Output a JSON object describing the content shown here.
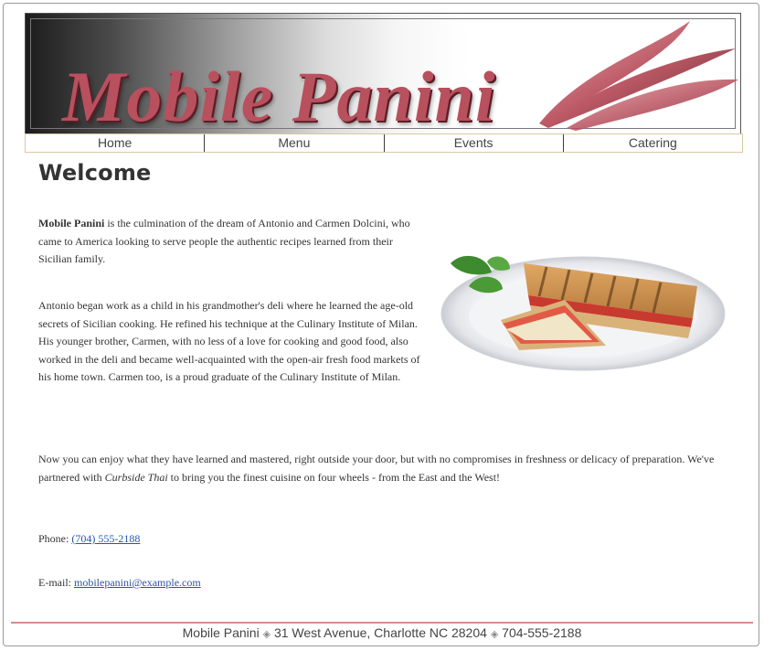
{
  "banner": {
    "logo": "Mobile Panini"
  },
  "nav": {
    "items": [
      "Home",
      "Menu",
      "Events",
      "Catering"
    ]
  },
  "main": {
    "heading": "Welcome",
    "p1_bold": "Mobile Panini",
    "p1_rest": " is the culmination of the dream of Antonio and Carmen Dolcini, who came to America looking to serve people the authentic recipes learned from their Sicilian family.",
    "p2": "Antonio began work as a child in his grandmother's deli where he learned the age-old secrets of Sicilian cooking. He refined his technique at the Culinary Institute of Milan. His younger brother, Carmen, with no less of a love for cooking and good food, also worked in the deli and became well-acquainted with the open-air fresh food markets of his home town. Carmen too, is a proud graduate of the Culinary Institute of Milan.",
    "p3_a": "Now you can enjoy what they have learned and mastered, right outside your door, but with no compromises in freshness or delicacy of preparation. We've partnered with ",
    "p3_italic": "Curbside Thai",
    "p3_b": " to bring you the finest cuisine on four wheels - from the East and the West!",
    "phone_label": "Phone: ",
    "phone_link": "(704) 555-2188",
    "email_label": "E-mail: ",
    "email_link": "mobilepanini@example.com"
  },
  "image": {
    "icon": "panini-sandwich-image"
  },
  "footer": {
    "name": "Mobile Panini",
    "address": "31 West Avenue, Charlotte NC   28204",
    "phone": "704-555-2188",
    "separator": "◈"
  }
}
